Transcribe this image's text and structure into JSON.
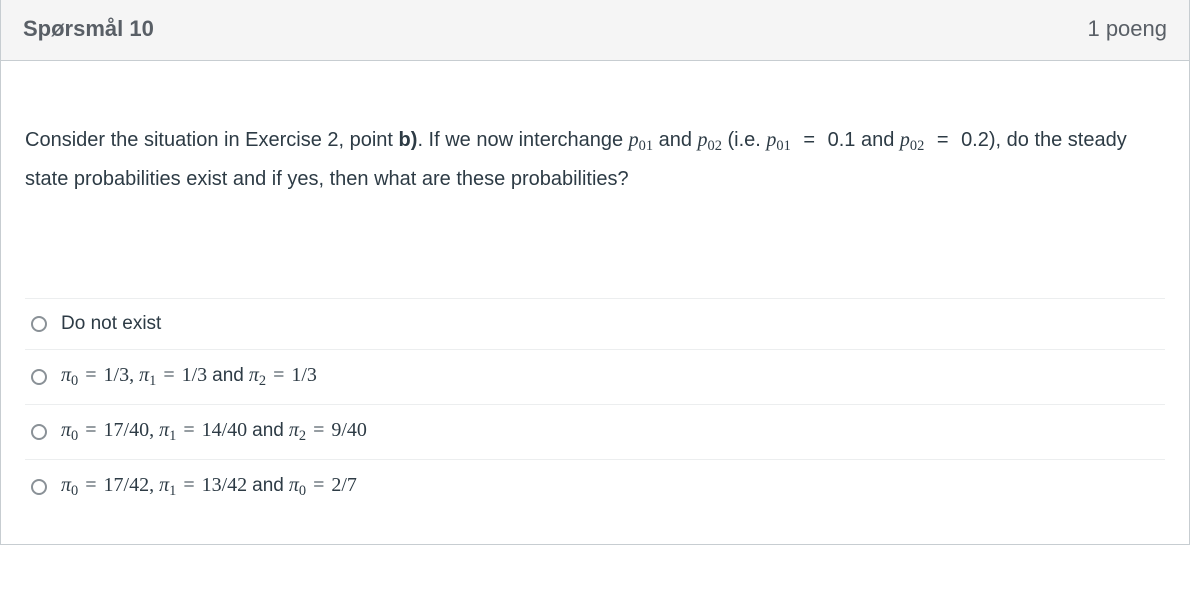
{
  "header": {
    "title": "Spørsmål 10",
    "points": "1 poeng"
  },
  "prompt": {
    "t1": "Consider the situation in Exercise 2, point ",
    "bold_b": "b)",
    "t2": ". If we now interchange ",
    "p01": "p",
    "p01_sub": "01",
    "t3": " and ",
    "p02": "p",
    "p02_sub": "02",
    "t4": " (i.e. ",
    "p01b": "p",
    "p01b_sub": "01",
    "eq1": " = ",
    "v1": "0.1",
    "t5": " and ",
    "p02b": "p",
    "p02b_sub": "02",
    "eq2": " = ",
    "v2": "0.2",
    "t6": "), do the steady state probabilities exist and if yes, then what are these probabilities?"
  },
  "answers": {
    "a": {
      "text": "Do not exist"
    },
    "b": {
      "pi0": "π",
      "s0": "0",
      "eq1": "=",
      "v1": "1/3,",
      "pi1": "π",
      "s1": "1",
      "eq2": "=",
      "v2": "1/3",
      "and": "and",
      "pi2": "π",
      "s2": "2",
      "eq3": "=",
      "v3": "1/3"
    },
    "c": {
      "pi0": "π",
      "s0": "0",
      "eq1": "=",
      "v1": "17/40,",
      "pi1": "π",
      "s1": "1",
      "eq2": "=",
      "v2": "14/40",
      "and": "and",
      "pi2": "π",
      "s2": "2",
      "eq3": "=",
      "v3": "9/40"
    },
    "d": {
      "pi0": "π",
      "s0": "0",
      "eq1": "=",
      "v1": "17/42,",
      "pi1": "π",
      "s1": "1",
      "eq2": "=",
      "v2": "13/42",
      "and": "and",
      "pi2": "π",
      "s2": "0",
      "eq3": "=",
      "v3": "2/7"
    }
  }
}
